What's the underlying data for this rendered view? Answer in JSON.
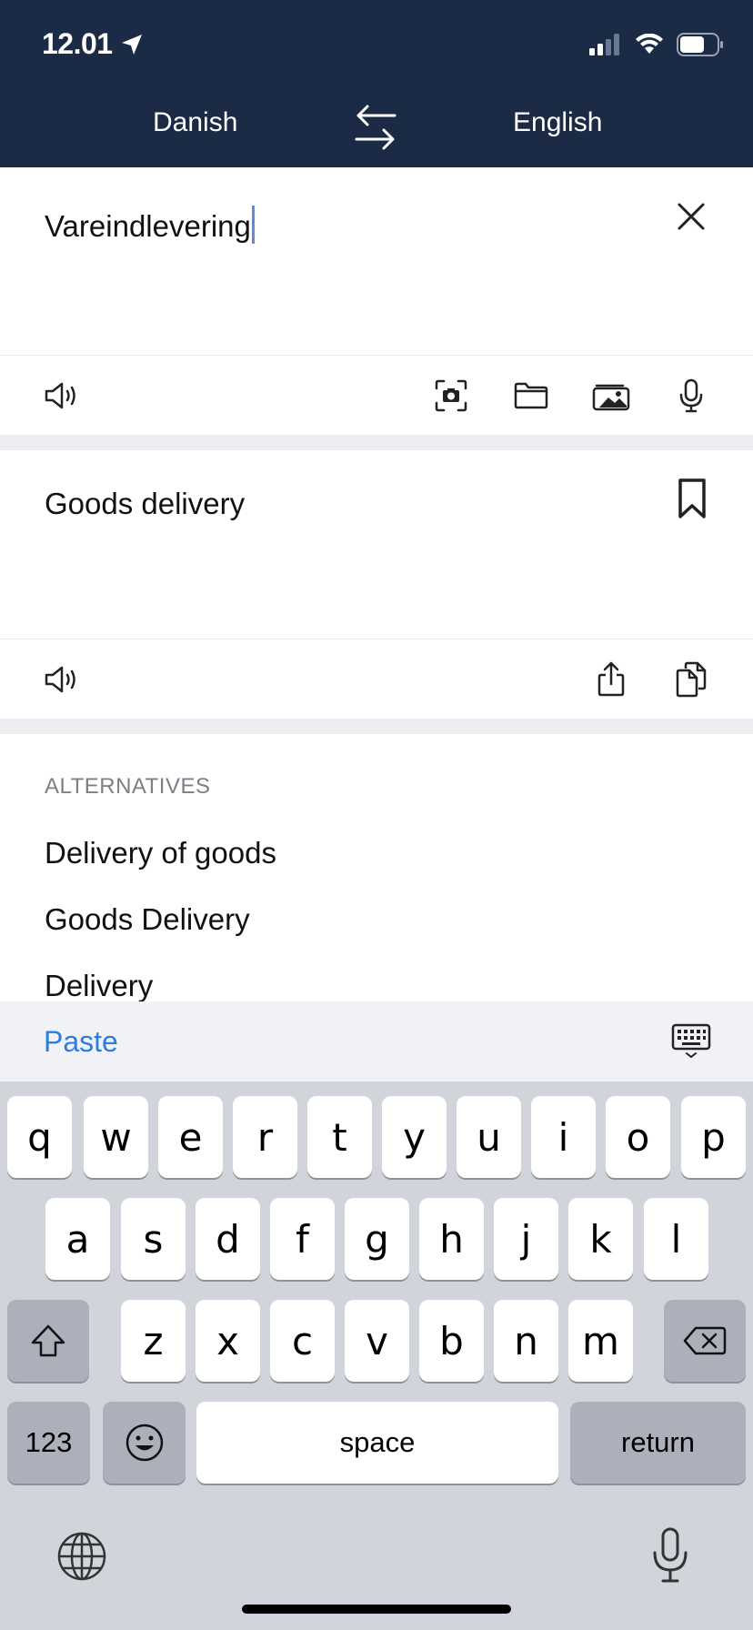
{
  "status_bar": {
    "time": "12.01",
    "icons": [
      "location-arrow-icon",
      "cellular-signal-icon",
      "wifi-icon",
      "battery-icon"
    ]
  },
  "header": {
    "source_language": "Danish",
    "target_language": "English",
    "swap_icon": "swap-arrows-icon",
    "background_color": "#1b2b45"
  },
  "input": {
    "text": "Vareindlevering",
    "clear_icon": "close-icon"
  },
  "input_toolbar": {
    "icons": [
      "speaker-icon",
      "camera-scan-icon",
      "folder-icon",
      "photos-icon",
      "microphone-icon"
    ]
  },
  "output": {
    "text": "Goods delivery",
    "bookmark_icon": "bookmark-icon"
  },
  "output_toolbar": {
    "icons": [
      "speaker-icon",
      "share-icon",
      "copy-icon"
    ]
  },
  "alternatives": {
    "heading": "ALTERNATIVES",
    "items": [
      "Delivery of goods",
      "Goods Delivery",
      "Delivery"
    ]
  },
  "paste_bar": {
    "paste_label": "Paste",
    "accent_color": "#2b7de0"
  },
  "keyboard": {
    "row1": [
      "q",
      "w",
      "e",
      "r",
      "t",
      "y",
      "u",
      "i",
      "o",
      "p"
    ],
    "row2": [
      "a",
      "s",
      "d",
      "f",
      "g",
      "h",
      "j",
      "k",
      "l"
    ],
    "row3": [
      "z",
      "x",
      "c",
      "v",
      "b",
      "n",
      "m"
    ],
    "numbers_label": "123",
    "space_label": "space",
    "return_label": "return"
  }
}
